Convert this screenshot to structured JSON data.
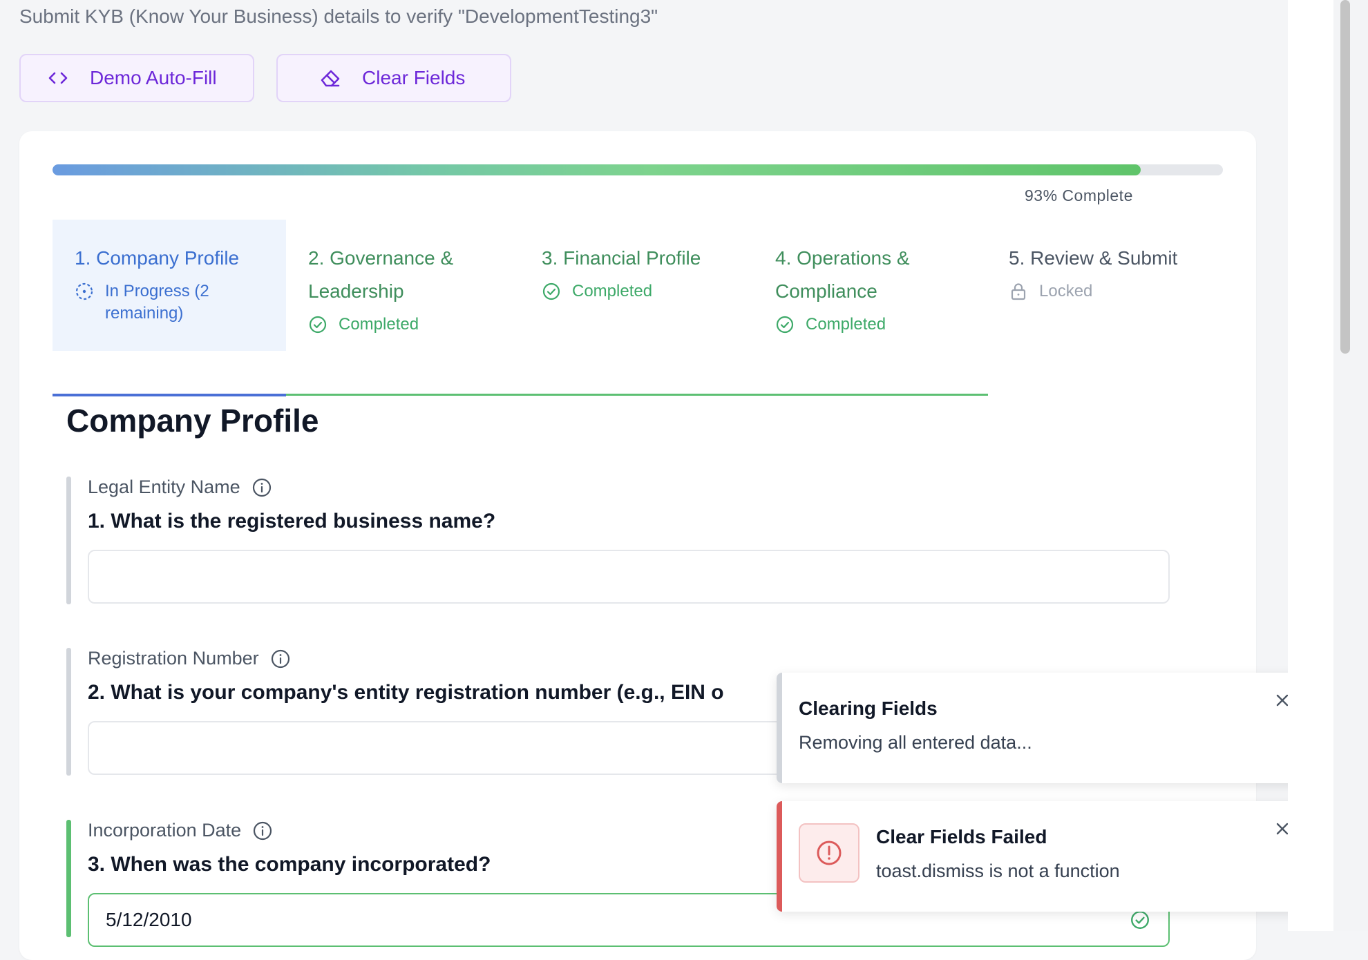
{
  "header": {
    "subtitle": "Submit KYB (Know Your Business) details to verify \"DevelopmentTesting3\""
  },
  "toolbar": {
    "demo_autofill_label": "Demo Auto-Fill",
    "demo_autofill_icon": "code-icon",
    "clear_fields_label": "Clear Fields",
    "clear_fields_icon": "eraser-icon"
  },
  "progress": {
    "percent": 93,
    "label": "93% Complete"
  },
  "steps": [
    {
      "title": "1. Company Profile",
      "status": "In Progress (2\nremaining)",
      "state": "in-progress",
      "icon": "dashed-circle-icon"
    },
    {
      "title": "2. Governance &\nLeadership",
      "status": "Completed",
      "state": "completed",
      "icon": "check-circle-icon"
    },
    {
      "title": "3. Financial Profile",
      "status": "Completed",
      "state": "completed",
      "icon": "check-circle-icon"
    },
    {
      "title": "4. Operations &\nCompliance",
      "status": "Completed",
      "state": "completed",
      "icon": "check-circle-icon"
    },
    {
      "title": "5. Review & Submit",
      "status": "Locked",
      "state": "locked",
      "icon": "lock-icon"
    }
  ],
  "section": {
    "title": "Company Profile"
  },
  "questions": [
    {
      "label": "Legal Entity Name",
      "question": "1. What is the registered business name?",
      "value": "",
      "state": "empty"
    },
    {
      "label": "Registration Number",
      "question": "2. What is your company's entity registration number (e.g., EIN o",
      "value": "",
      "state": "empty"
    },
    {
      "label": "Incorporation Date",
      "question": "3. When was the company incorporated?",
      "value": "5/12/2010",
      "state": "valid"
    }
  ],
  "toasts": [
    {
      "title": "Clearing Fields",
      "message": "Removing all entered data...",
      "type": "info"
    },
    {
      "title": "Clear Fields Failed",
      "message": "toast.dismiss is not a function",
      "type": "error",
      "icon": "alert-circle-icon"
    }
  ],
  "colors": {
    "accent_purple": "#6d28d9",
    "active_blue": "#3b6fd0",
    "success_green": "#3da968",
    "error_red": "#dc5a5a"
  }
}
